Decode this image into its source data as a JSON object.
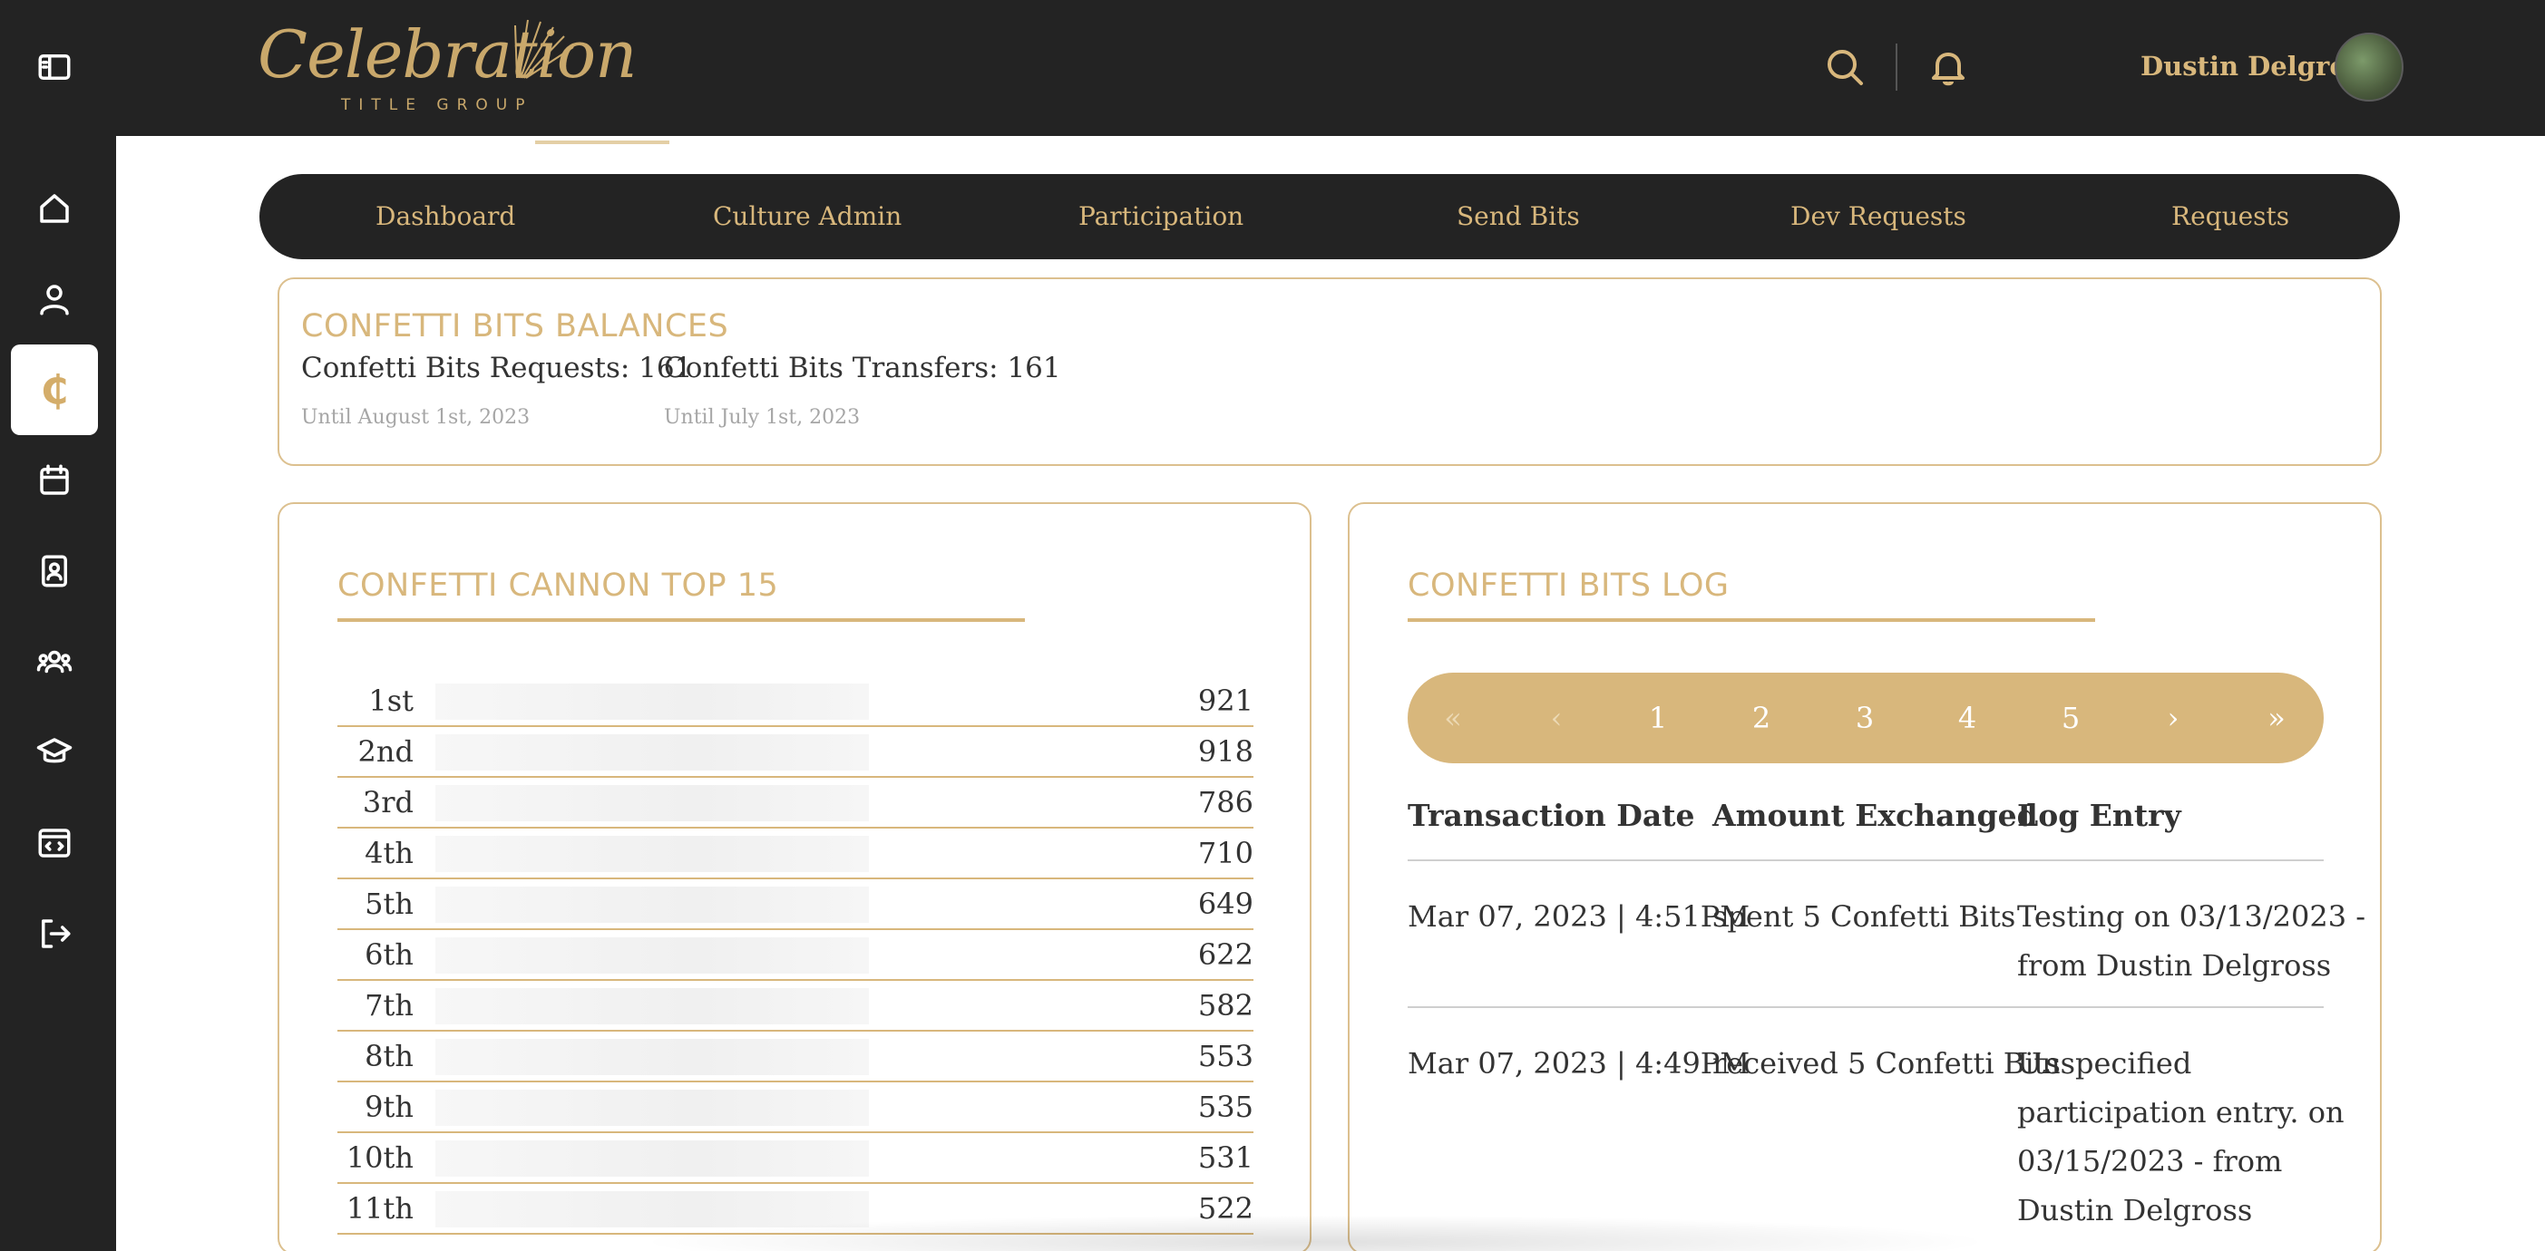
{
  "brand": {
    "logo_script": "Celebration",
    "logo_sub": "TITLE GROUP"
  },
  "header": {
    "user_name": "Dustin Delgross"
  },
  "sidebar": {
    "items": [
      {
        "icon": "sidebar-toggle-icon"
      },
      {
        "icon": "home-icon"
      },
      {
        "icon": "profile-icon"
      },
      {
        "icon": "confetti-bits-icon",
        "glyph": "₵",
        "active": true
      },
      {
        "icon": "calendar-icon"
      },
      {
        "icon": "directory-icon"
      },
      {
        "icon": "groups-icon"
      },
      {
        "icon": "learning-icon"
      },
      {
        "icon": "dev-code-icon"
      },
      {
        "icon": "logout-icon"
      }
    ]
  },
  "nav": {
    "items": [
      "Dashboard",
      "Culture Admin",
      "Participation",
      "Send Bits",
      "Dev Requests",
      "Requests"
    ]
  },
  "balances": {
    "title": "CONFETTI BITS BALANCES",
    "requests": "Confetti Bits Requests: 161",
    "requests_until": "Until August 1st, 2023",
    "transfers": "Confetti Bits Transfers: 161",
    "transfers_until": "Until July 1st, 2023"
  },
  "leaderboard": {
    "title": "CONFETTI CANNON TOP 15",
    "rows": [
      {
        "rank": "1st",
        "value": "921"
      },
      {
        "rank": "2nd",
        "value": "918"
      },
      {
        "rank": "3rd",
        "value": "786"
      },
      {
        "rank": "4th",
        "value": "710"
      },
      {
        "rank": "5th",
        "value": "649"
      },
      {
        "rank": "6th",
        "value": "622"
      },
      {
        "rank": "7th",
        "value": "582"
      },
      {
        "rank": "8th",
        "value": "553"
      },
      {
        "rank": "9th",
        "value": "535"
      },
      {
        "rank": "10th",
        "value": "531"
      },
      {
        "rank": "11th",
        "value": "522"
      }
    ]
  },
  "log": {
    "title": "CONFETTI BITS LOG",
    "pagination": [
      "«",
      "‹",
      "1",
      "2",
      "3",
      "4",
      "5",
      "›",
      "»"
    ],
    "columns": [
      "Transaction Date",
      "Amount Exchanged",
      "Log Entry"
    ],
    "rows": [
      {
        "date": "Mar 07, 2023 | 4:51PM",
        "amount": "spent 5 Confetti Bits",
        "entry_lines": [
          "Testing on 03/13/2023 -",
          "from Dustin Delgross"
        ]
      },
      {
        "date": "Mar 07, 2023 | 4:49PM",
        "amount": "received 5 Confetti Bits",
        "entry_lines": [
          "Unspecified",
          "participation entry. on",
          "03/15/2023 - from",
          "Dustin Delgross"
        ]
      }
    ]
  },
  "colors": {
    "accent": "#d8b77c",
    "dark": "#232323",
    "border": "#dcc08f"
  }
}
